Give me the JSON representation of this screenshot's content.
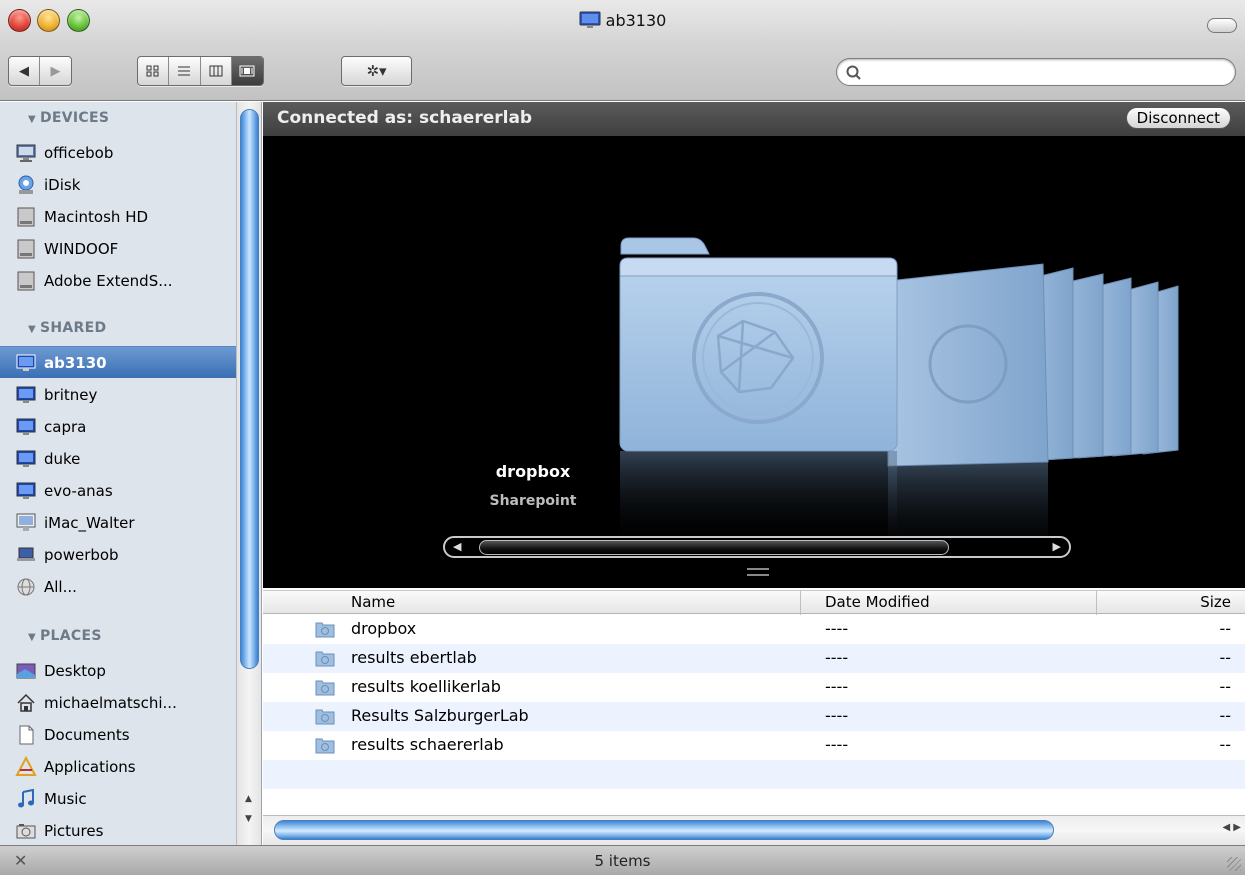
{
  "window": {
    "title": "ab3130"
  },
  "toolbar": {
    "search_placeholder": "",
    "back_glyph": "◀",
    "forward_glyph": "▶",
    "action_glyph": "✲▾"
  },
  "sidebar": {
    "sections": {
      "devices": "DEVICES",
      "shared": "SHARED",
      "places": "PLACES"
    },
    "devices": [
      {
        "label": "officebob",
        "icon": "computer-icon"
      },
      {
        "label": "iDisk",
        "icon": "idisk-icon"
      },
      {
        "label": "Macintosh HD",
        "icon": "harddisk-icon"
      },
      {
        "label": "WINDOOF",
        "icon": "harddisk-icon"
      },
      {
        "label": "Adobe ExtendS...",
        "icon": "harddisk-icon"
      }
    ],
    "shared": [
      {
        "label": "ab3130",
        "icon": "network-computer-icon",
        "selected": true
      },
      {
        "label": "britney",
        "icon": "network-computer-icon"
      },
      {
        "label": "capra",
        "icon": "network-computer-icon"
      },
      {
        "label": "duke",
        "icon": "network-computer-icon"
      },
      {
        "label": "evo-anas",
        "icon": "network-computer-icon"
      },
      {
        "label": "iMac_Walter",
        "icon": "imac-icon"
      },
      {
        "label": "powerbob",
        "icon": "laptop-icon"
      },
      {
        "label": "All...",
        "icon": "network-globe-icon"
      }
    ],
    "places": [
      {
        "label": "Desktop",
        "icon": "desktop-icon"
      },
      {
        "label": "michaelmatschi...",
        "icon": "home-icon"
      },
      {
        "label": "Documents",
        "icon": "documents-icon"
      },
      {
        "label": "Applications",
        "icon": "applications-icon"
      },
      {
        "label": "Music",
        "icon": "music-icon"
      },
      {
        "label": "Pictures",
        "icon": "pictures-icon"
      }
    ]
  },
  "connection": {
    "text": "Connected as: schaererlab",
    "disconnect_label": "Disconnect"
  },
  "coverflow": {
    "selected_name": "dropbox",
    "selected_kind": "Sharepoint"
  },
  "list": {
    "columns": {
      "name": "Name",
      "date": "Date Modified",
      "size": "Size"
    },
    "rows": [
      {
        "name": "dropbox",
        "date": "----",
        "size": "--"
      },
      {
        "name": "results ebertlab",
        "date": "----",
        "size": "--"
      },
      {
        "name": "results koellikerlab",
        "date": "----",
        "size": "--"
      },
      {
        "name": "Results SalzburgerLab",
        "date": "----",
        "size": "--"
      },
      {
        "name": "results schaererlab",
        "date": "----",
        "size": "--"
      }
    ]
  },
  "status": {
    "items_text": "5 items"
  },
  "colors": {
    "selection": "#3a6fb5",
    "sidebar_bg": "#dde4ec",
    "folder_blue": "#9ebfe0"
  }
}
